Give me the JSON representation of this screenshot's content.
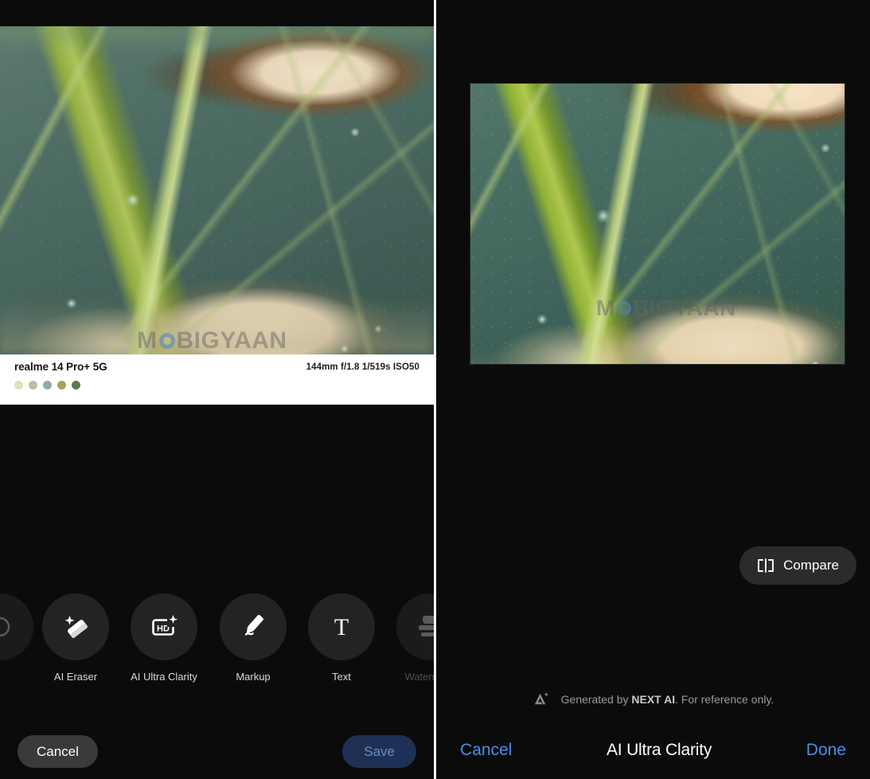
{
  "left_panel": {
    "photo": {
      "watermark": {
        "prefix": "M",
        "circle": "O",
        "suffix": "BIGYAAN"
      },
      "alt": "macro-photo-of-green-leaf-with-veins-and-water-droplets"
    },
    "exif": {
      "model": "realme 14 Pro+ 5G",
      "specs": "144mm  f/1.8  1/519s  ISO50",
      "focal_length": "144mm",
      "aperture": "f/1.8",
      "shutter": "1/519s",
      "iso": "ISO50",
      "swatches": [
        "#e3ddb8",
        "#b9bfa4",
        "#8fada6",
        "#a4a064",
        "#5a7a4e"
      ]
    },
    "toolbar": {
      "items": [
        {
          "label": "",
          "icon": "partial-left-icon",
          "edge": true
        },
        {
          "label": "AI Eraser",
          "icon": "eraser-sparkle-icon",
          "edge": false
        },
        {
          "label": "AI Ultra Clarity",
          "icon": "hd-sparkle-icon",
          "edge": false
        },
        {
          "label": "Markup",
          "icon": "pencil-icon",
          "edge": false
        },
        {
          "label": "Text",
          "icon": "text-t-icon",
          "edge": false
        },
        {
          "label": "Watermark",
          "icon": "stamp-icon",
          "edge": true
        }
      ]
    },
    "actions": {
      "cancel_label": "Cancel",
      "save_label": "Save",
      "save_enabled": false,
      "cancel_bg": "#3a3a3a",
      "save_bg": "#1e3155",
      "save_fg": "#6b8dc4"
    }
  },
  "right_panel": {
    "photo": {
      "watermark": {
        "prefix": "M",
        "circle": "O",
        "suffix": "BIGYAAN"
      },
      "alt": "enhanced-macro-photo-of-green-leaf"
    },
    "compare": {
      "label": "Compare",
      "icon": "compare-split-icon"
    },
    "generated_note": {
      "icon": "ai-sparkle-icon",
      "prefix": "Generated by ",
      "brand": "NEXT AI",
      "suffix": ". For reference only."
    },
    "bottom_nav": {
      "cancel_label": "Cancel",
      "title": "AI Ultra Clarity",
      "done_label": "Done",
      "link_color": "#4a8fe8"
    }
  }
}
